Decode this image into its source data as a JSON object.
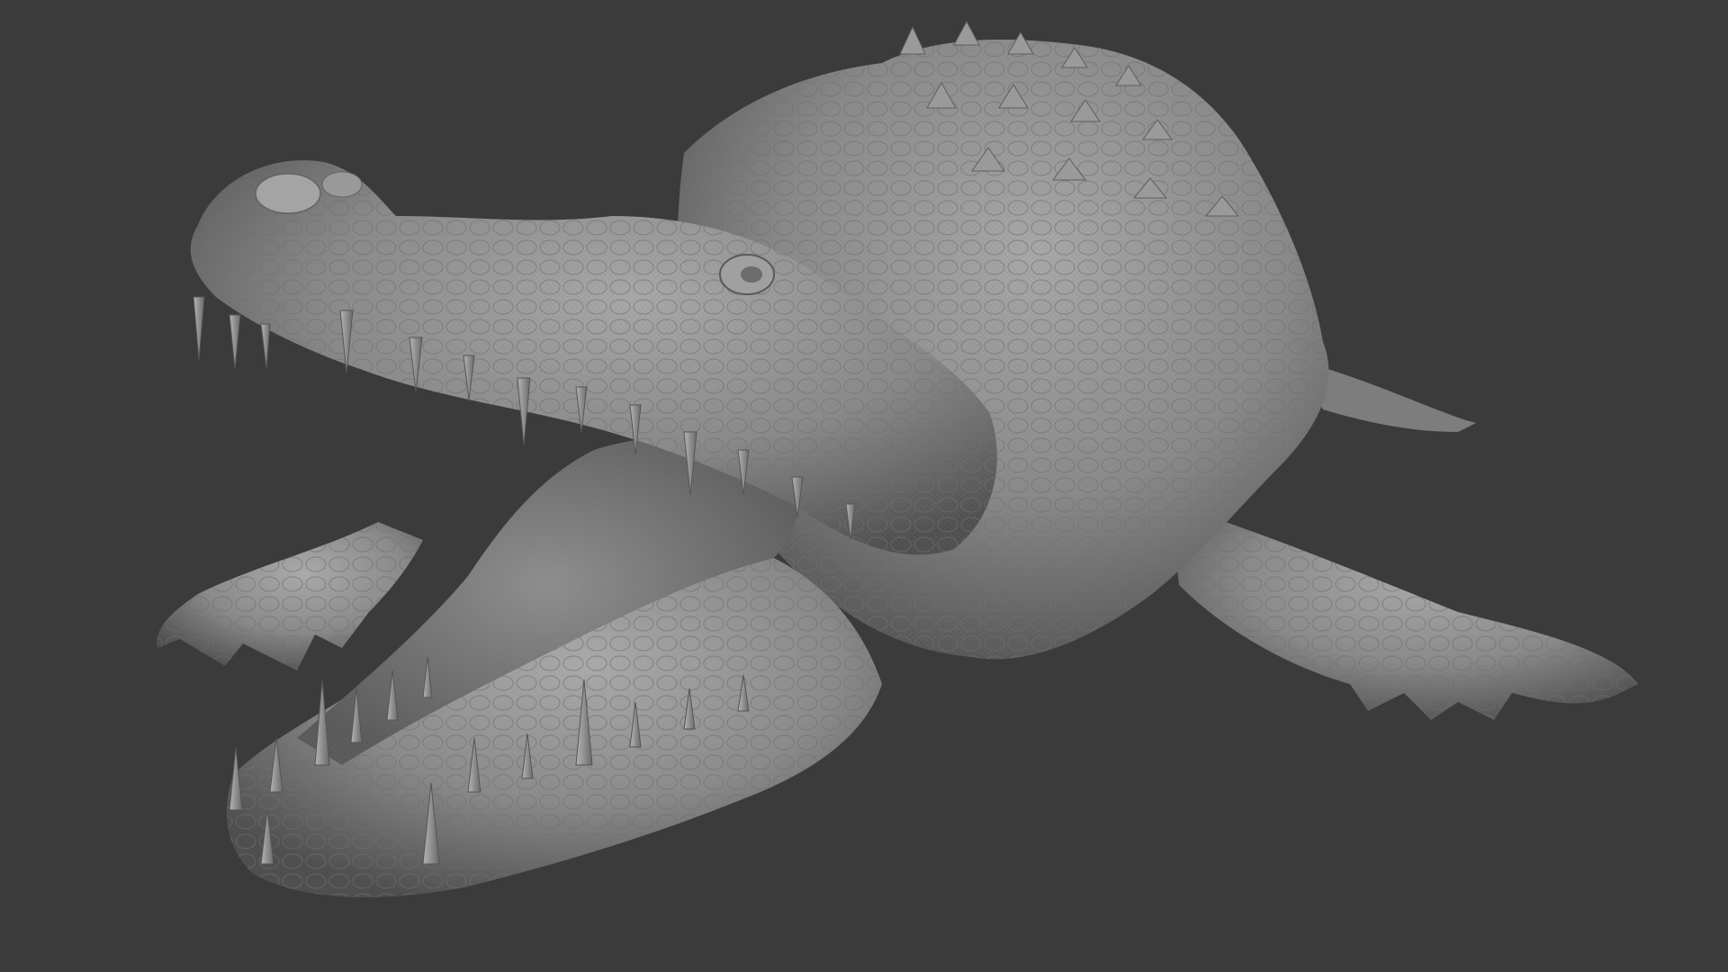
{
  "viewport": {
    "background_color": "#3b3b3c",
    "subject": "crocodile-sculpt",
    "material": "clay-grey",
    "material_color": "#8e8e8e",
    "wireframe_overlay": true
  }
}
